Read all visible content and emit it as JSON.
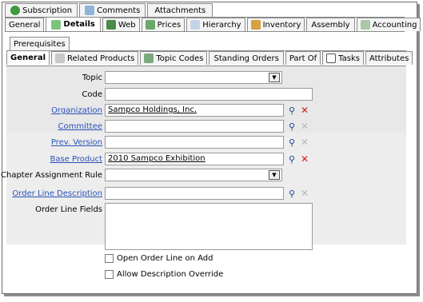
{
  "tabs_row1": [
    {
      "label": "Subscription",
      "icon": "person-icon"
    },
    {
      "label": "Comments",
      "icon": "comments-icon"
    },
    {
      "label": "Attachments",
      "icon": ""
    }
  ],
  "tabs_row2": [
    {
      "label": "General",
      "icon": ""
    },
    {
      "label": "Details",
      "icon": "details-icon",
      "active": true
    },
    {
      "label": "Web",
      "icon": "web-icon"
    },
    {
      "label": "Prices",
      "icon": "prices-icon"
    },
    {
      "label": "Hierarchy",
      "icon": "hierarchy-icon"
    },
    {
      "label": "Inventory",
      "icon": "inventory-icon"
    },
    {
      "label": "Assembly",
      "icon": ""
    },
    {
      "label": "Accounting",
      "icon": "accounting-icon"
    }
  ],
  "tabs_row3": [
    {
      "label": "Prerequisites"
    }
  ],
  "tabs_row4": [
    {
      "label": "General",
      "icon": "",
      "active": true
    },
    {
      "label": "Related Products",
      "icon": "related-icon"
    },
    {
      "label": "Topic Codes",
      "icon": "topic-codes-icon"
    },
    {
      "label": "Standing Orders",
      "icon": ""
    },
    {
      "label": "Part Of",
      "icon": ""
    },
    {
      "label": "Tasks",
      "icon": "tasks-icon"
    },
    {
      "label": "Attributes",
      "icon": ""
    }
  ],
  "form": {
    "topic_label": "Topic",
    "topic_value": "",
    "code_label": "Code",
    "code_value": "",
    "organization_label": "Organization",
    "organization_value": "Sampco Holdings, Inc.",
    "committee_label": "Committee",
    "committee_value": "",
    "prev_version_label": "Prev. Version",
    "prev_version_value": "",
    "base_product_label": "Base Product",
    "base_product_value": "2010 Sampco Exhibition",
    "chapter_rule_label": "Chapter Assignment Rule",
    "chapter_rule_value": "",
    "order_line_desc_label": "Order Line Description",
    "order_line_desc_value": "",
    "order_line_fields_label": "Order Line Fields",
    "open_order_line_label": "Open Order Line on Add",
    "allow_desc_override_label": "Allow Description Override"
  },
  "colors": {
    "link": "#2a52b8",
    "panel_shade": "#e8e8e8",
    "delete_active": "#d02020"
  }
}
